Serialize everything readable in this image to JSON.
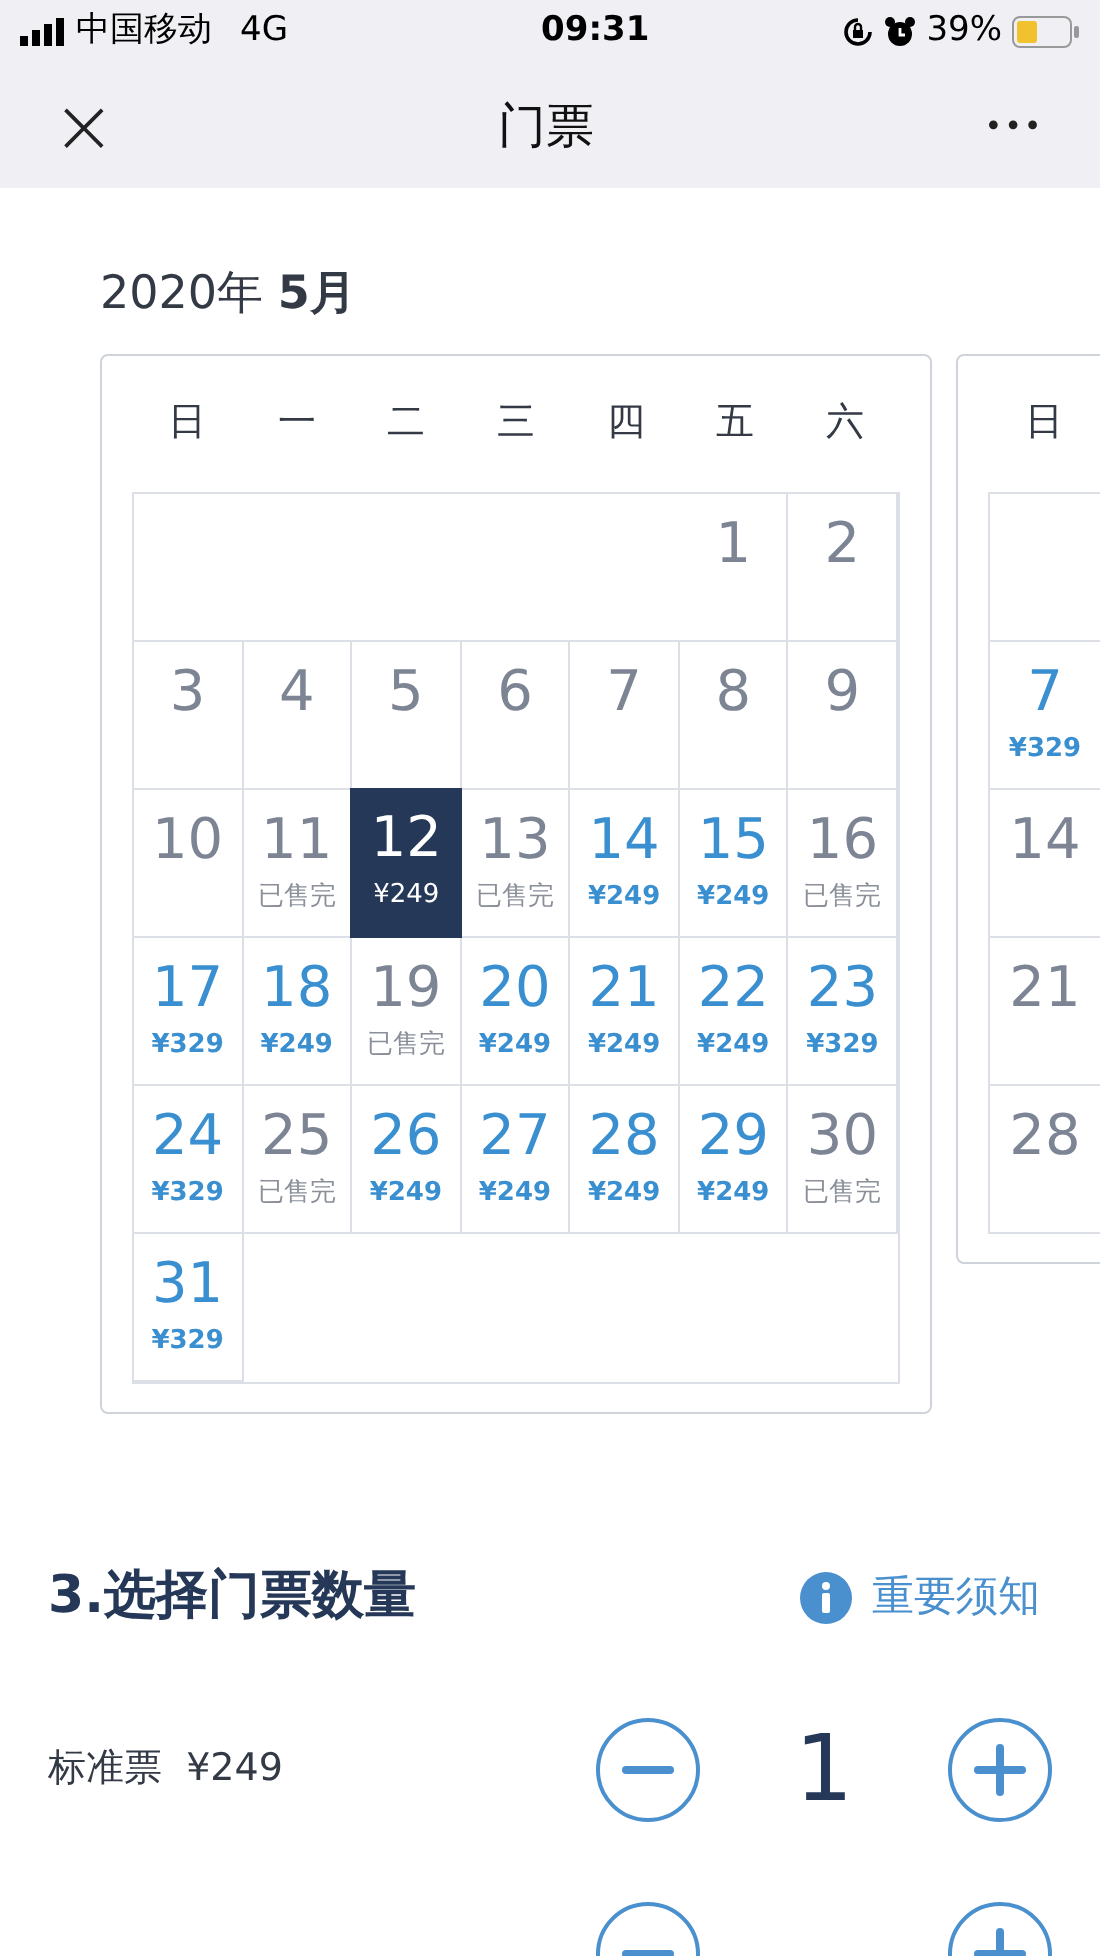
{
  "status_bar": {
    "carrier": "中国移动",
    "network": "4G",
    "time": "09:31",
    "battery": "39%"
  },
  "nav": {
    "close": "×",
    "title": "门票",
    "more": "•••"
  },
  "month": {
    "year": "2020年",
    "month": "5月"
  },
  "weekdays": [
    "日",
    "一",
    "二",
    "三",
    "四",
    "五",
    "六"
  ],
  "days": [
    {
      "kind": "empty"
    },
    {
      "kind": "empty"
    },
    {
      "kind": "empty"
    },
    {
      "kind": "empty"
    },
    {
      "kind": "empty"
    },
    {
      "kind": "past",
      "day": "1",
      "selected": false
    },
    {
      "kind": "past",
      "day": "2",
      "selected": false
    },
    {
      "kind": "past",
      "day": "3",
      "selected": false
    },
    {
      "kind": "past",
      "day": "4",
      "selected": false
    },
    {
      "kind": "past",
      "day": "5",
      "selected": false
    },
    {
      "kind": "past",
      "day": "6",
      "selected": false
    },
    {
      "kind": "past",
      "day": "7",
      "selected": false
    },
    {
      "kind": "past",
      "day": "8",
      "selected": false
    },
    {
      "kind": "past",
      "day": "9",
      "selected": false
    },
    {
      "kind": "past",
      "day": "10",
      "selected": false
    },
    {
      "kind": "soldout",
      "day": "11",
      "note": "已售完",
      "selected": false
    },
    {
      "kind": "available",
      "day": "12",
      "note": "¥249",
      "selected": true
    },
    {
      "kind": "soldout",
      "day": "13",
      "note": "已售完",
      "selected": false
    },
    {
      "kind": "available",
      "day": "14",
      "note": "¥249",
      "selected": false
    },
    {
      "kind": "available",
      "day": "15",
      "note": "¥249",
      "selected": false
    },
    {
      "kind": "soldout",
      "day": "16",
      "note": "已售完",
      "selected": false
    },
    {
      "kind": "available",
      "day": "17",
      "note": "¥329",
      "selected": false
    },
    {
      "kind": "available",
      "day": "18",
      "note": "¥249",
      "selected": false
    },
    {
      "kind": "soldout",
      "day": "19",
      "note": "已售完",
      "selected": false
    },
    {
      "kind": "available",
      "day": "20",
      "note": "¥249",
      "selected": false
    },
    {
      "kind": "available",
      "day": "21",
      "note": "¥249",
      "selected": false
    },
    {
      "kind": "available",
      "day": "22",
      "note": "¥249",
      "selected": false
    },
    {
      "kind": "available",
      "day": "23",
      "note": "¥329",
      "selected": false
    },
    {
      "kind": "available",
      "day": "24",
      "note": "¥329",
      "selected": false
    },
    {
      "kind": "soldout",
      "day": "25",
      "note": "已售完",
      "selected": false
    },
    {
      "kind": "available",
      "day": "26",
      "note": "¥249",
      "selected": false
    },
    {
      "kind": "available",
      "day": "27",
      "note": "¥249",
      "selected": false
    },
    {
      "kind": "available",
      "day": "28",
      "note": "¥249",
      "selected": false
    },
    {
      "kind": "available",
      "day": "29",
      "note": "¥249",
      "selected": false
    },
    {
      "kind": "soldout",
      "day": "30",
      "note": "已售完",
      "selected": false
    },
    {
      "kind": "available",
      "day": "31",
      "note": "¥329",
      "selected": false
    }
  ],
  "next_month": {
    "weekday": "日",
    "days": [
      {
        "kind": "empty"
      },
      {
        "kind": "available",
        "day": "7",
        "note": "¥329",
        "selected": false
      },
      {
        "kind": "past",
        "day": "14",
        "selected": false
      },
      {
        "kind": "past",
        "day": "21",
        "selected": false
      },
      {
        "kind": "past",
        "day": "28",
        "selected": false
      }
    ]
  },
  "quantity": {
    "title": "3.选择门票数量",
    "notice": "重要须知",
    "tickets": [
      {
        "kind": "full",
        "name": "标准票",
        "price": "¥249",
        "count": "1"
      },
      {
        "kind": "cut"
      }
    ]
  }
}
